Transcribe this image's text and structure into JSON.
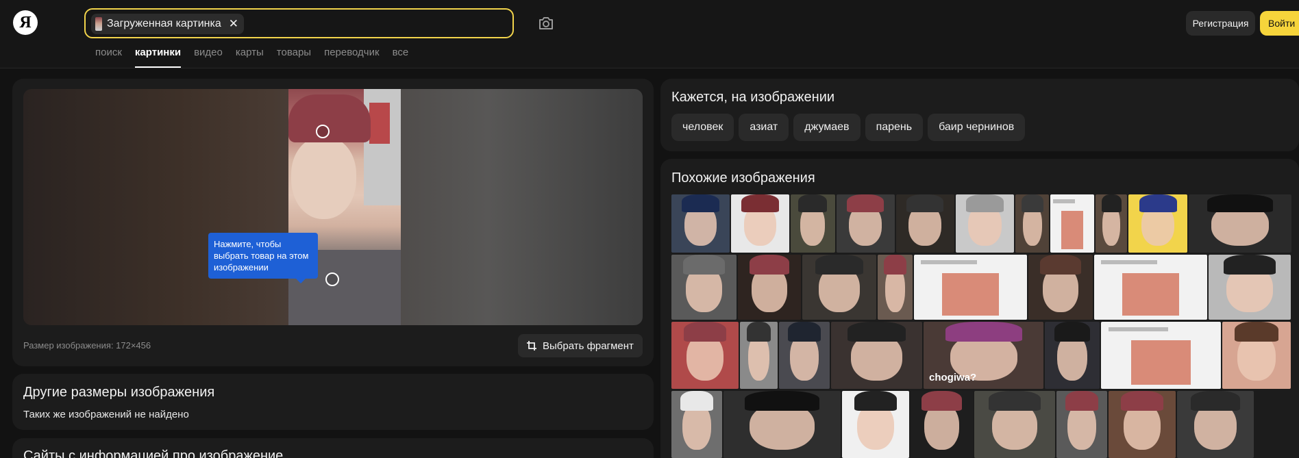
{
  "header": {
    "logo": "Я",
    "search_chip_label": "Загруженная картинка",
    "search_chip_close": "✕",
    "tabs": [
      {
        "label": "поиск"
      },
      {
        "label": "картинки"
      },
      {
        "label": "видео"
      },
      {
        "label": "карты"
      },
      {
        "label": "товары"
      },
      {
        "label": "переводчик"
      },
      {
        "label": "все"
      }
    ],
    "active_tab": "картинки",
    "register_label": "Регистрация",
    "login_label": "Войти"
  },
  "viewer": {
    "tooltip": "Нажмите, чтобы выбрать товар на этом изображении",
    "image_size": "Размер изображения: 172×456",
    "crop_button": "Выбрать фрагмент"
  },
  "other_sizes": {
    "title": "Другие размеры изображения",
    "message": "Таких же изображений не найдено"
  },
  "sites": {
    "title": "Сайты с информацией про изображение"
  },
  "tags": {
    "title": "Кажется, на изображении",
    "items": [
      "человек",
      "азиат",
      "джумаев",
      "парень",
      "баир чернинов"
    ]
  },
  "similar": {
    "title": "Похожие изображения",
    "overlay_text": "chogiwa?"
  },
  "colors": {
    "accent_yellow": "#f6d43b",
    "tooltip_blue": "#1e60d6",
    "background": "#121212"
  }
}
